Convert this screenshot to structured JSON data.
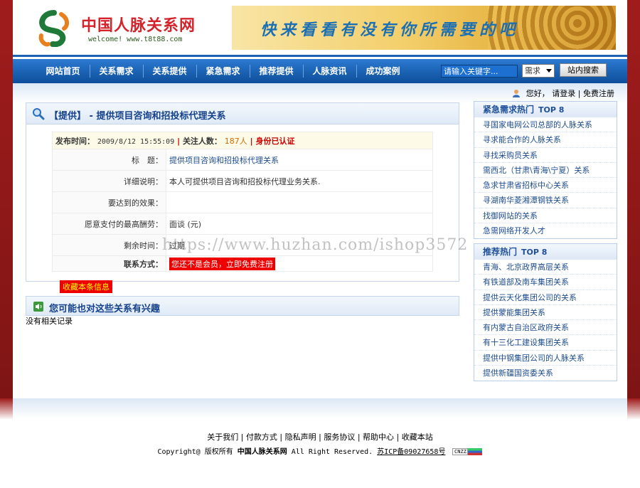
{
  "header": {
    "site_title": "中国人脉关系网",
    "site_subtitle": "welcome! www.t8t88.com",
    "banner_text": "快来看看有没有你所需要的吧"
  },
  "nav": {
    "items": [
      "网站首页",
      "关系需求",
      "关系提供",
      "紧急需求",
      "推荐提供",
      "人脉资讯",
      "成功案例"
    ],
    "search_placeholder": "请输入关键字...",
    "search_type": "需求",
    "search_button": "站内搜索"
  },
  "account": {
    "greeting": "您好，",
    "login": "请登录",
    "sep": "|",
    "register": "免费注册"
  },
  "detail": {
    "title": "【提供】 - 提供项目咨询和招投标代理关系",
    "publish_label": "发布时间：",
    "publish_time": "2009/8/12 15:55:09",
    "sep": "|",
    "attention_label": "关注人数：",
    "attention_count": "187人",
    "verified": "身份已认证",
    "rows": [
      {
        "label": "标　题：",
        "value": "提供项目咨询和招投标代理关系"
      },
      {
        "label": "详细说明：",
        "value": "本人可提供项目咨询和招投标代理业务关系."
      },
      {
        "label": "要达到的效果：",
        "value": ""
      },
      {
        "label": "愿意支付的最高酬劳：",
        "value": "面谈 (元)"
      },
      {
        "label": "剩余时间：",
        "value": "过期"
      }
    ],
    "contact_label": "联系方式：",
    "contact_value": "您还不是会员，立即免费注册",
    "favorite_button": "收藏本条信息"
  },
  "related": {
    "title": "您可能也对这些关系有兴趣",
    "empty": "没有相关记录"
  },
  "urgent": {
    "title": "紧急需求热门",
    "top": "TOP 8",
    "items": [
      "寻国家电网公司总部的人脉关系",
      "寻求能合作的人脉关系",
      "寻找采购员关系",
      "需西北（甘肃\\青海\\宁夏）关系",
      "急求甘肃省招标中心关系",
      "寻湖南华菱湘潭钢铁关系",
      "找御网站的关系",
      "急需网络开发人才"
    ]
  },
  "recommend": {
    "title": "推荐热门",
    "top": "TOP 8",
    "items": [
      "青海、北京政界高层关系",
      "有铁道部及南车集团关系",
      "提供云天化集团公司的关系",
      "提供蒙能集团关系",
      "有内蒙古自治区政府关系",
      "有十三化工建设集团关系",
      "提供中钢集团公司的人脉关系",
      "提供新疆国资委关系"
    ]
  },
  "watermark": "https://www.huzhan.com/ishop3572",
  "footer": {
    "links": [
      "关于我们",
      "付款方式",
      "隐私声明",
      "服务协议",
      "帮助中心",
      "收藏本站"
    ],
    "copyright_prefix": "Copyright@ 版权所有",
    "copyright_site": "中国人脉关系网",
    "copyright_suffix": "All Right Reserved.",
    "icp": "苏ICP备09027658号",
    "cnzz": "CNZZ"
  },
  "colors": {
    "brand_red": "#d3232b",
    "nav_blue": "#1a63b4",
    "link_blue": "#1d4c8f",
    "side_frame": "#a01c1c"
  }
}
